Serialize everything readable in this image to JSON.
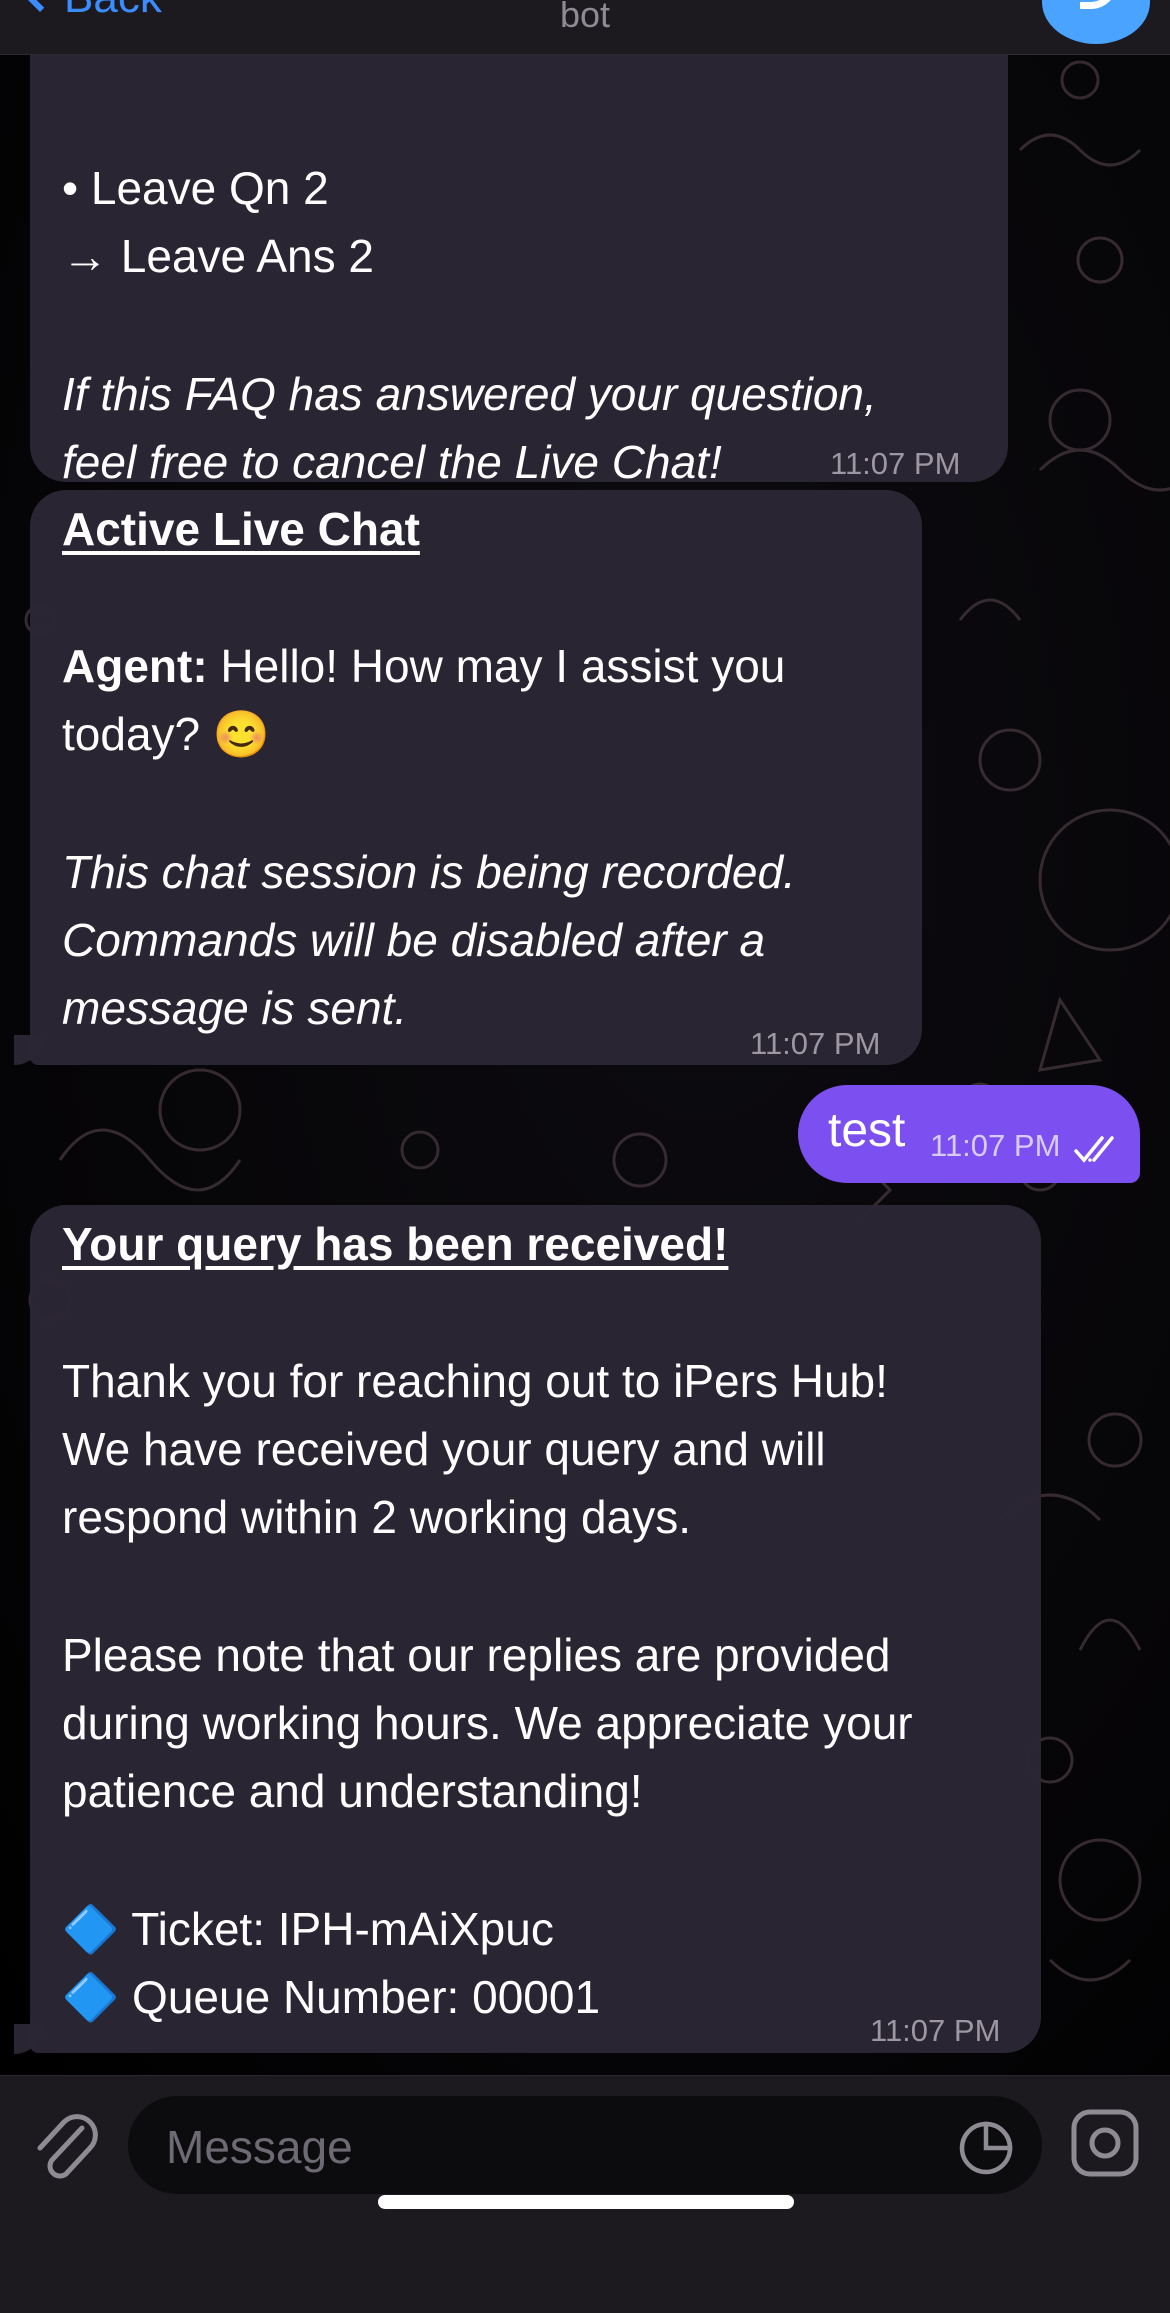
{
  "header": {
    "back_label": "Back",
    "subtitle": "bot"
  },
  "messages": {
    "faq": {
      "lines": [
        "• Leave Qn 2",
        "→ Leave Ans 2"
      ],
      "note_line1": "If this FAQ has answered your question,",
      "note_line2": "feel free to cancel the Live Chat!",
      "time": "11:07 PM"
    },
    "live_chat": {
      "title": "Active Live Chat",
      "agent_label": "Agent:",
      "agent_text1": "Hello! How may I assist you",
      "agent_text2": "today? 😊",
      "note1": "This chat session is being recorded.",
      "note2": "Commands will be disabled after a",
      "note3": "message is sent.",
      "time": "11:07 PM"
    },
    "outgoing": {
      "text": "test",
      "time": "11:07 PM",
      "status": "read"
    },
    "query_received": {
      "title": "Your query has been received!",
      "para1": [
        "Thank you for reaching out to iPers Hub!",
        "We have received your query and will",
        "respond within 2 working days."
      ],
      "para2": [
        "Please note that our replies are provided",
        "during working hours. We appreciate your",
        "patience and understanding!"
      ],
      "ticket": "🔷 Ticket: IPH-mAiXpuc",
      "queue": "🔷 Queue Number: 00001",
      "time": "11:07 PM"
    }
  },
  "composer": {
    "placeholder": "Message",
    "icons": [
      "paperclip-icon",
      "moon-timer-icon",
      "sticker-icon"
    ]
  },
  "colors": {
    "accent": "#3b8cff",
    "outgoing_bubble": "#7b4ff0",
    "incoming_bubble": "#2c2734"
  }
}
